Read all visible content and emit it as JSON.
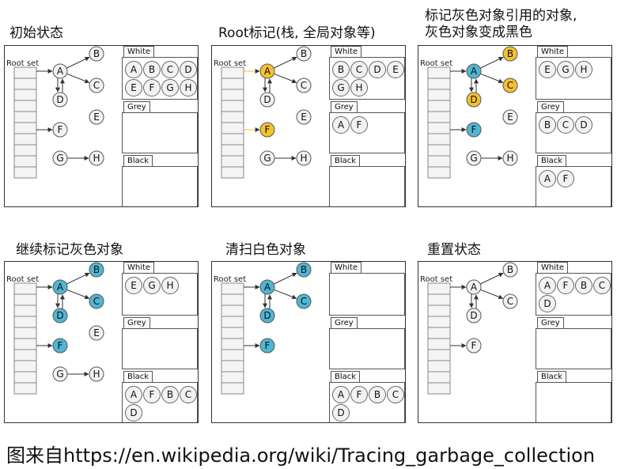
{
  "colors": {
    "white_node": "#f2f2f2",
    "grey_node": "#f5c12e",
    "black_node": "#4fb6d3",
    "stroke": "#555555"
  },
  "labels": {
    "root_set": "Root set",
    "white": "White",
    "grey": "Grey",
    "black": "Black"
  },
  "panels": [
    {
      "title": "初始状态",
      "nodes": {
        "A": "white",
        "B": "white",
        "C": "white",
        "D": "white",
        "E": "white",
        "F": "white",
        "G": "white",
        "H": "white"
      },
      "white_set": [
        "A",
        "B",
        "C",
        "D",
        "E",
        "F",
        "G",
        "H"
      ],
      "grey_set": [],
      "black_set": []
    },
    {
      "title": "Root标记(栈, 全局对象等)",
      "nodes": {
        "A": "grey",
        "B": "white",
        "C": "white",
        "D": "white",
        "E": "white",
        "F": "grey",
        "G": "white",
        "H": "white"
      },
      "white_set": [
        "B",
        "C",
        "D",
        "E",
        "G",
        "H"
      ],
      "grey_set": [
        "A",
        "F"
      ],
      "black_set": []
    },
    {
      "title": "标记灰色对象引用的对象,\n灰色对象变成黑色",
      "nodes": {
        "A": "black",
        "B": "grey",
        "C": "grey",
        "D": "grey",
        "E": "white",
        "F": "black",
        "G": "white",
        "H": "white"
      },
      "white_set": [
        "E",
        "G",
        "H"
      ],
      "grey_set": [
        "B",
        "C",
        "D"
      ],
      "black_set": [
        "A",
        "F"
      ]
    },
    {
      "title": "继续标记灰色对象",
      "nodes": {
        "A": "black",
        "B": "black",
        "C": "black",
        "D": "black",
        "E": "white",
        "F": "black",
        "G": "white",
        "H": "white"
      },
      "white_set": [
        "E",
        "G",
        "H"
      ],
      "grey_set": [],
      "black_set": [
        "A",
        "F",
        "B",
        "C",
        "D"
      ]
    },
    {
      "title": "清扫白色对象",
      "nodes": {
        "A": "black",
        "B": "black",
        "C": "black",
        "D": "black",
        "F": "black"
      },
      "white_set": [],
      "grey_set": [],
      "black_set": [
        "A",
        "F",
        "B",
        "C",
        "D"
      ]
    },
    {
      "title": "重置状态",
      "nodes": {
        "A": "white",
        "B": "white",
        "C": "white",
        "D": "white",
        "F": "white"
      },
      "white_set": [
        "A",
        "F",
        "B",
        "C",
        "D"
      ],
      "grey_set": [],
      "black_set": []
    }
  ],
  "footer": "图来自https://en.wikipedia.org/wiki/Tracing_garbage_collection"
}
